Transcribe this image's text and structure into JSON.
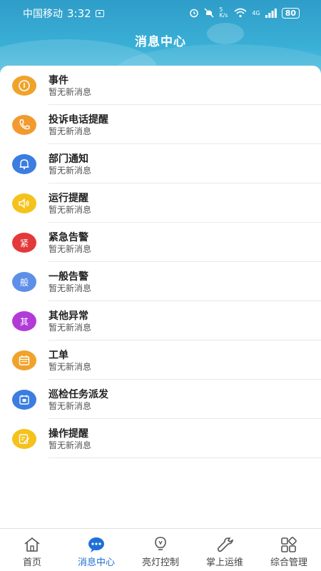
{
  "status_bar": {
    "carrier": "中国移动",
    "time": "3:32",
    "speed": "5 K/s",
    "network": "4G",
    "battery": "80"
  },
  "header": {
    "title": "消息中心"
  },
  "messages": [
    {
      "title": "事件",
      "subtitle": "暂无新消息",
      "icon": "info-icon",
      "color": "#f0a32b"
    },
    {
      "title": "投诉电话提醒",
      "subtitle": "暂无新消息",
      "icon": "phone-icon",
      "color": "#f29a30"
    },
    {
      "title": "部门通知",
      "subtitle": "暂无新消息",
      "icon": "bell-icon",
      "color": "#3b7de0"
    },
    {
      "title": "运行提醒",
      "subtitle": "暂无新消息",
      "icon": "speaker-icon",
      "color": "#f5c21b"
    },
    {
      "title": "紧急告警",
      "subtitle": "暂无新消息",
      "icon": "urgent-icon",
      "glyph": "紧",
      "color": "#e3393a"
    },
    {
      "title": "一般告警",
      "subtitle": "暂无新消息",
      "icon": "general-icon",
      "glyph": "般",
      "color": "#5d8fe8"
    },
    {
      "title": "其他异常",
      "subtitle": "暂无新消息",
      "icon": "other-icon",
      "glyph": "其",
      "color": "#b23bd8"
    },
    {
      "title": "工单",
      "subtitle": "暂无新消息",
      "icon": "calendar-icon",
      "color": "#f0a32b"
    },
    {
      "title": "巡检任务派发",
      "subtitle": "暂无新消息",
      "icon": "task-icon",
      "color": "#3b7de0"
    },
    {
      "title": "操作提醒",
      "subtitle": "暂无新消息",
      "icon": "edit-icon",
      "color": "#f5c21b"
    }
  ],
  "tabs": [
    {
      "label": "首页",
      "icon": "home-icon",
      "active": false
    },
    {
      "label": "消息中心",
      "icon": "chat-icon",
      "active": true
    },
    {
      "label": "亮灯控制",
      "icon": "bulb-icon",
      "active": false
    },
    {
      "label": "掌上运维",
      "icon": "wrench-icon",
      "active": false
    },
    {
      "label": "综合管理",
      "icon": "grid-icon",
      "active": false
    }
  ],
  "colors": {
    "accent": "#1f6fd6",
    "header_top": "#2f9dc9",
    "header_bottom": "#5cc3e2"
  }
}
